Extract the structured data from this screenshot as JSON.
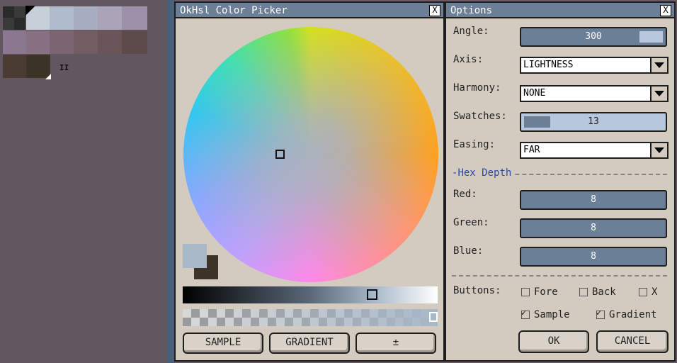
{
  "palette": {
    "swatches": [
      {
        "color": "#2a2a2a"
      },
      {
        "color": "#3a3a3a"
      },
      {
        "color": "#c7d0d8"
      },
      {
        "color": "#b0bccc"
      },
      {
        "color": "#a8aec0"
      },
      {
        "color": "#a9a4b8"
      },
      {
        "color": "#9e90a8"
      },
      {
        "color": "#8a7890"
      },
      {
        "color": "#87707f"
      },
      {
        "color": "#7c6472"
      },
      {
        "color": "#745d62"
      },
      {
        "color": "#6b5558"
      },
      {
        "color": "#5d4a4a"
      },
      {
        "color": "#4a3c33"
      },
      {
        "color": "#3c3426"
      }
    ],
    "pause_label": "II"
  },
  "picker": {
    "title": "OkHsl Color Picker",
    "close_label": "X",
    "fore_color": "#a8b8c8",
    "back_color": "#3e3328",
    "buttons": {
      "sample": "SAMPLE",
      "gradient": "GRADIENT",
      "plusminus": "±"
    }
  },
  "options": {
    "title": "Options",
    "close_label": "X",
    "angle": {
      "label": "Angle:",
      "value": "300",
      "fraction": 0.83
    },
    "axis": {
      "label": "Axis:",
      "value": "LIGHTNESS"
    },
    "harmony": {
      "label": "Harmony:",
      "value": "NONE"
    },
    "swatches": {
      "label": "Swatches:",
      "value": "13",
      "fraction": 0.19
    },
    "easing": {
      "label": "Easing:",
      "value": "FAR"
    },
    "hex_depth_label": "Hex Depth",
    "red": {
      "label": "Red:",
      "value": "8"
    },
    "green": {
      "label": "Green:",
      "value": "8"
    },
    "blue": {
      "label": "Blue:",
      "value": "8"
    },
    "buttons_label": "Buttons:",
    "checks": {
      "fore": {
        "label": "Fore",
        "checked": false
      },
      "back": {
        "label": "Back",
        "checked": false
      },
      "x": {
        "label": "X",
        "checked": false
      },
      "sample": {
        "label": "Sample",
        "checked": true
      },
      "gradient": {
        "label": "Gradient",
        "checked": true
      }
    },
    "ok_label": "OK",
    "cancel_label": "CANCEL"
  }
}
